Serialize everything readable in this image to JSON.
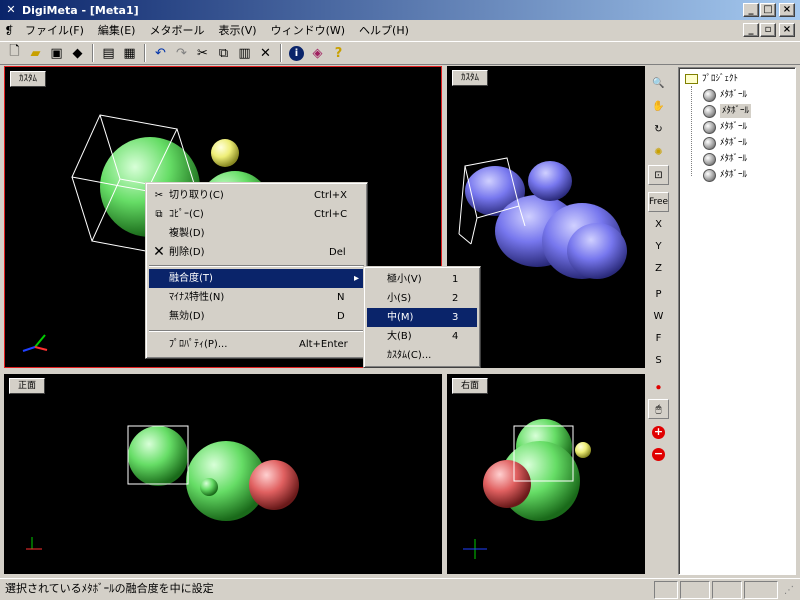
{
  "window": {
    "title": "DigiMeta - [Meta1]"
  },
  "menubar": {
    "items": [
      "ファイル(F)",
      "編集(E)",
      "メタボール",
      "表示(V)",
      "ウィンドウ(W)",
      "ヘルプ(H)"
    ]
  },
  "viewports": {
    "perspective_left": "ｶｽﾀﾑ",
    "perspective_right": "ｶｽﾀﾑ",
    "front": "正面",
    "right": "右面"
  },
  "view_toolbar": {
    "labels": [
      "Free",
      "X",
      "Y",
      "Z",
      "P",
      "W",
      "F",
      "S"
    ]
  },
  "tree": {
    "root": "ﾌﾟﾛｼﾞｪｸﾄ",
    "items": [
      "ﾒﾀﾎﾞｰﾙ",
      "ﾒﾀﾎﾞｰﾙ",
      "ﾒﾀﾎﾞｰﾙ",
      "ﾒﾀﾎﾞｰﾙ",
      "ﾒﾀﾎﾞｰﾙ",
      "ﾒﾀﾎﾞｰﾙ"
    ],
    "selected_index": 1
  },
  "context_menu": {
    "items": [
      {
        "label": "切り取り(C)",
        "shortcut": "Ctrl+X",
        "icon": "scissors-icon"
      },
      {
        "label": "ｺﾋﾟｰ(C)",
        "shortcut": "Ctrl+C",
        "icon": "copy-icon"
      },
      {
        "label": "複製(D)",
        "shortcut": ""
      },
      {
        "label": "削除(D)",
        "shortcut": "Del",
        "icon": "delete-x-icon"
      },
      {
        "label": "融合度(T)",
        "shortcut": "",
        "submenu": true,
        "selected": true
      },
      {
        "label": "ﾏｲﾅｽ特性(N)",
        "shortcut": "N"
      },
      {
        "label": "無効(D)",
        "shortcut": "D"
      },
      {
        "label": "ﾌﾟﾛﾊﾟﾃｨ(P)...",
        "shortcut": "Alt+Enter"
      }
    ]
  },
  "submenu": {
    "items": [
      {
        "label": "極小(V)",
        "value": "1"
      },
      {
        "label": "小(S)",
        "value": "2"
      },
      {
        "label": "中(M)",
        "value": "3",
        "selected": true
      },
      {
        "label": "大(B)",
        "value": "4"
      },
      {
        "label": "ｶｽﾀﾑ(C)...",
        "value": ""
      }
    ]
  },
  "status": {
    "message": "選択されているﾒﾀﾎﾞｰﾙの融合度を中に設定"
  },
  "colors": {
    "title_bar": "#0a246a",
    "selection": "#0a246a",
    "ball_green": "#66dd66",
    "ball_red": "#e06060",
    "ball_yellow": "#eeee77",
    "blob_blue": "#7777ee"
  }
}
